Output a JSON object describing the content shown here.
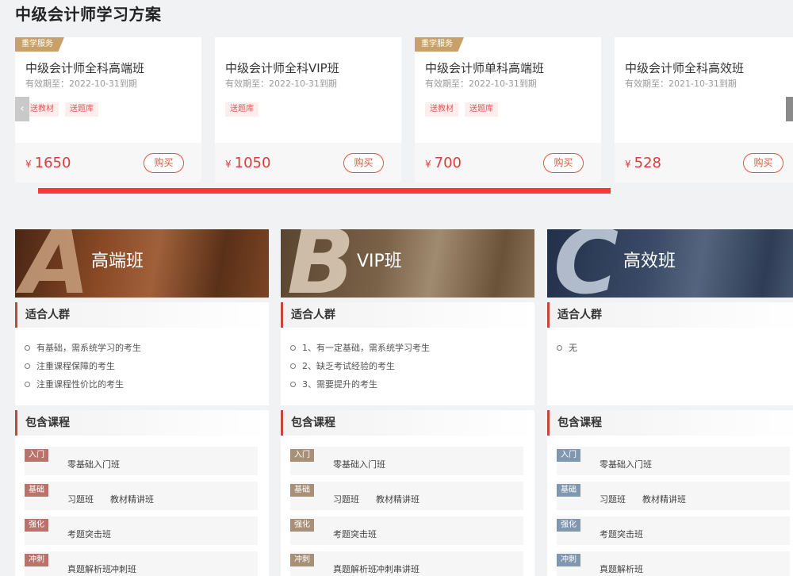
{
  "page": {
    "title": "中级会计师学习方案"
  },
  "carousel": {
    "progress": 0.85
  },
  "products": [
    {
      "tag": "重学服务",
      "name": "中级会计师全科高端班",
      "valid": "有效期至：2022-10-31到期",
      "gifts": [
        "送教材",
        "送题库"
      ],
      "currency": "¥",
      "price": "1650",
      "buy": "购买"
    },
    {
      "tag": "",
      "name": "中级会计师全科VIP班",
      "valid": "有效期至：2022-10-31到期",
      "gifts": [
        "送题库"
      ],
      "currency": "¥",
      "price": "1050",
      "buy": "购买"
    },
    {
      "tag": "重学服务",
      "name": "中级会计师单科高端班",
      "valid": "有效期至：2022-10-31到期",
      "gifts": [
        "送教材",
        "送题库"
      ],
      "currency": "¥",
      "price": "700",
      "buy": "购买"
    },
    {
      "tag": "",
      "name": "中级会计师全科高效班",
      "valid": "有效期至：2021-10-31到期",
      "gifts": [],
      "currency": "¥",
      "price": "528",
      "buy": "购买"
    }
  ],
  "plans": [
    {
      "letter": "A",
      "title": "高端班",
      "audience_heading": "适合人群",
      "audience": [
        "有基础，需系统学习的考生",
        "注重课程保障的考生",
        "注重课程性价比的考生"
      ],
      "courses_heading": "包含课程",
      "courses": [
        {
          "stage": "入门",
          "items": [
            "零基础入门班"
          ]
        },
        {
          "stage": "基础",
          "items": [
            "习题班",
            "教材精讲班"
          ]
        },
        {
          "stage": "强化",
          "items": [
            "考题突击班"
          ]
        },
        {
          "stage": "冲刺",
          "items": [
            "真题解析班",
            "冲刺班"
          ]
        }
      ]
    },
    {
      "letter": "B",
      "title": "VIP班",
      "audience_heading": "适合人群",
      "audience": [
        "1、有一定基础，需系统学习考生",
        "2、缺乏考试经验的考生",
        "3、需要提升的考生"
      ],
      "courses_heading": "包含课程",
      "courses": [
        {
          "stage": "入门",
          "items": [
            "零基础入门班"
          ]
        },
        {
          "stage": "基础",
          "items": [
            "习题班",
            "教材精讲班"
          ]
        },
        {
          "stage": "强化",
          "items": [
            "考题突击班"
          ]
        },
        {
          "stage": "冲刺",
          "items": [
            "真题解析班",
            "冲刺串讲班"
          ]
        }
      ]
    },
    {
      "letter": "C",
      "title": "高效班",
      "audience_heading": "适合人群",
      "audience": [
        "无"
      ],
      "courses_heading": "包含课程",
      "courses": [
        {
          "stage": "入门",
          "items": [
            "零基础入门班"
          ]
        },
        {
          "stage": "基础",
          "items": [
            "习题班",
            "教材精讲班"
          ]
        },
        {
          "stage": "强化",
          "items": [
            "考题突击班"
          ]
        },
        {
          "stage": "冲刺",
          "items": [
            "真题解析班"
          ]
        }
      ]
    }
  ],
  "colors": {
    "accent_red": "#f23a3a",
    "tag_gold": "#c8a16a",
    "plan_a_banner": "#6b3a20",
    "plan_b_banner": "#6a5238",
    "plan_c_banner": "#2e3d55",
    "plan_a_badge": "#b8736a",
    "plan_b_badge": "#a89078",
    "plan_c_badge": "#7f98b0"
  },
  "icons": {
    "prev": "chevron-left-icon",
    "next": "chevron-right-icon",
    "bullet": "circle-bullet-icon"
  }
}
